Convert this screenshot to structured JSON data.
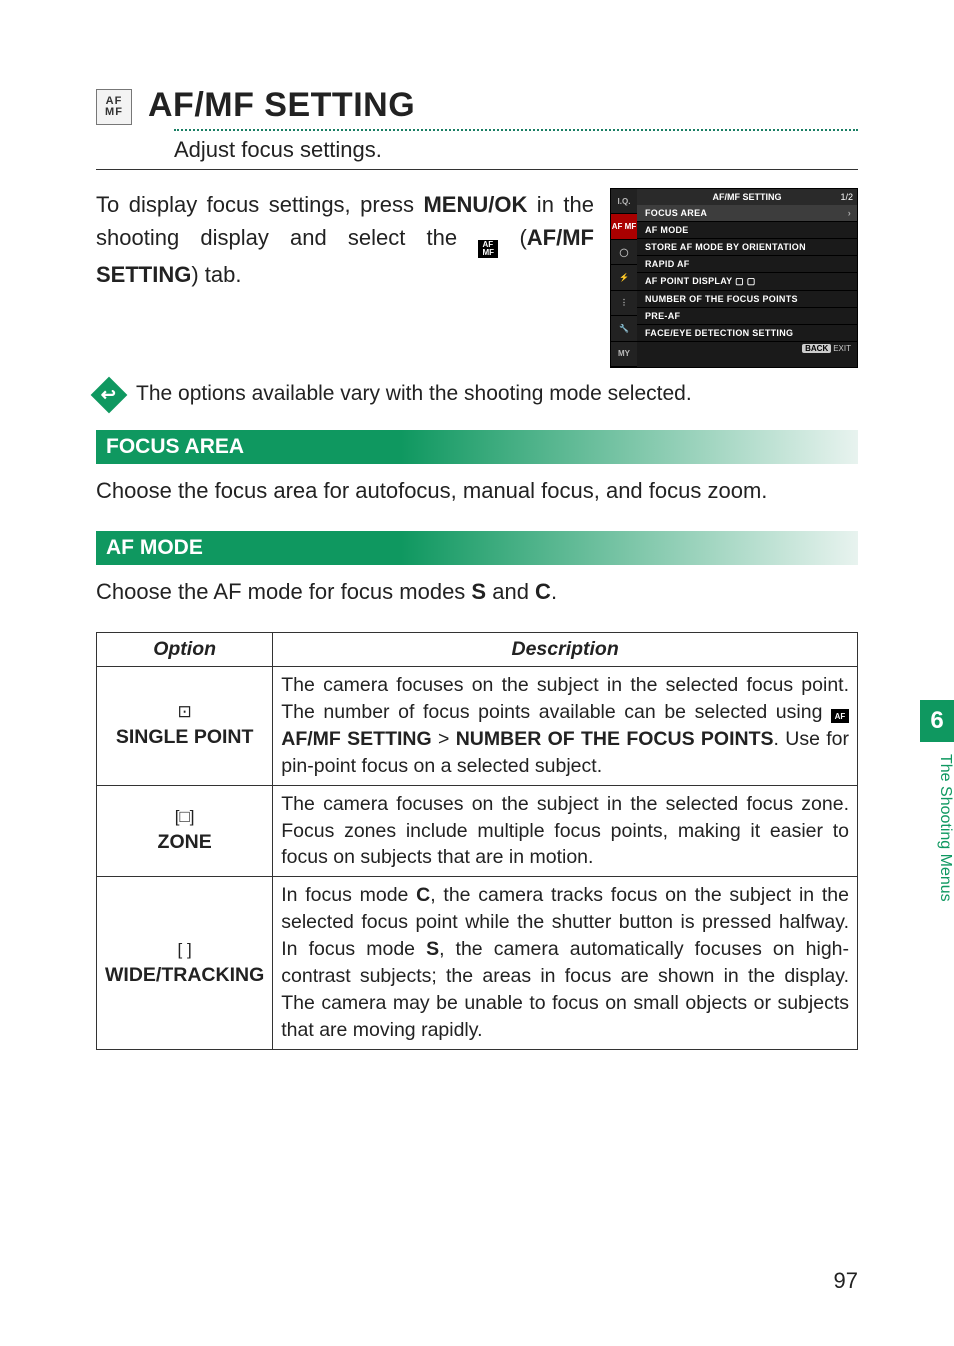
{
  "header": {
    "title": "AF/MF SETTING",
    "subtitle": "Adjust focus settings.",
    "icon_name": "af-mf-icon"
  },
  "intro": {
    "line1": "To display focus settings, press ",
    "menu_ok": "MENU/OK",
    "line2": " in the shooting display and select the ",
    "line3": " (",
    "tab_label": "AF/MF SETTING",
    "line4": ") tab."
  },
  "menu_screenshot": {
    "title": "AF/MF SETTING",
    "page": "1/2",
    "tabs": [
      "I.Q.",
      "AF MF",
      "◯",
      "⚡",
      "⋮",
      "🔧",
      "MY"
    ],
    "items": [
      "FOCUS AREA",
      "AF MODE",
      "STORE AF MODE BY ORIENTATION",
      "RAPID AF",
      "AF POINT DISPLAY ▢ ▢",
      "NUMBER OF THE FOCUS POINTS",
      "PRE-AF",
      "FACE/EYE DETECTION SETTING"
    ],
    "footer_badge": "BACK",
    "footer_text": "EXIT"
  },
  "note": "The options available vary with the shooting mode selected.",
  "sections": {
    "focus_area": {
      "title": "FOCUS AREA",
      "body": "Choose the focus area for autofocus, manual focus, and focus zoom."
    },
    "af_mode": {
      "title": "AF MODE",
      "body_pre": "Choose the AF mode for focus modes ",
      "mode_s": "S",
      "body_mid": " and ",
      "mode_c": "C",
      "body_post": "."
    }
  },
  "table": {
    "head_option": "Option",
    "head_desc": "Description",
    "rows": [
      {
        "symbol": "⊡",
        "name": "SINGLE POINT",
        "desc_pre": "The camera focuses on the subject in the selected focus point. The number of focus points available can be selected using ",
        "path_bold": "AF/MF SETTING",
        "gt": " > ",
        "path_bold2": "NUMBER OF THE FOCUS POINTS",
        "desc_post": ". Use for pin-point focus on a selected subject."
      },
      {
        "symbol": "[□]",
        "name": "ZONE",
        "desc": "The camera focuses on the subject in the selected focus zone. Focus zones include multiple focus points, making it easier to focus on subjects that are in motion."
      },
      {
        "symbol": "[   ]",
        "name": "WIDE/TRACKING",
        "desc_pre": "In focus mode ",
        "c": "C",
        "desc_mid1": ", the camera tracks focus on the subject in the selected focus point while the shutter button is pressed halfway. In focus mode ",
        "s": "S",
        "desc_mid2": ", the camera automatically focuses on high-contrast subjects; the areas in focus are shown in the display. The camera may be unable to focus on small objects or subjects that are moving rapidly."
      }
    ]
  },
  "side": {
    "chapter": "6",
    "label": "The Shooting Menus"
  },
  "page_number": "97"
}
